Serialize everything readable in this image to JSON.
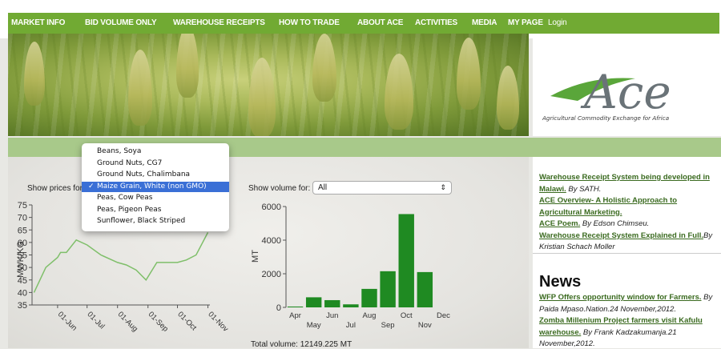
{
  "nav": {
    "items": [
      "MARKET INFO",
      "BID VOLUME ONLY",
      "WAREHOUSE RECEIPTS",
      "HOW TO TRADE",
      "ABOUT ACE",
      "ACTIVITIES",
      "MEDIA",
      "MY PAGE"
    ],
    "login": "Login"
  },
  "logo": {
    "mark": "Ace",
    "tagline": "Agricultural Commodity Exchange for Africa"
  },
  "prices": {
    "label": "Show prices for",
    "options": [
      "Beans, Soya",
      "Ground Nuts, CG7",
      "Ground Nuts, Chalimbana",
      "Maize Grain, White (non GMO)",
      "Peas, Cow Peas",
      "Peas, Pigeon Peas",
      "Sunflower, Black Striped"
    ],
    "selected": "Maize Grain, White (non GMO)",
    "check": "✓"
  },
  "volume": {
    "label": "Show volume for:",
    "select_value": "All",
    "select_arrow": "⇕",
    "total": "Total volume: 12149.225 MT"
  },
  "colors": {
    "accent": "#71aa33",
    "bar": "#1f8a22",
    "line": "#7fbf6a",
    "link": "#3a6a1f",
    "selected": "#3a6fd6"
  },
  "chart_data": [
    {
      "type": "line",
      "ylabel": "MWK/KG",
      "ylim": [
        35,
        75
      ],
      "yticks": [
        35,
        40,
        45,
        50,
        55,
        60,
        65,
        70,
        75
      ],
      "xticks": [
        "01-Jun",
        "01-Jul",
        "01-Aug",
        "01-Sep",
        "01-Oct",
        "01-Nov"
      ],
      "x": [
        "2012-05-08",
        "2012-05-20",
        "2012-06-01",
        "2012-06-04",
        "2012-06-10",
        "2012-06-20",
        "2012-07-01",
        "2012-07-15",
        "2012-08-01",
        "2012-08-10",
        "2012-08-20",
        "2012-08-30",
        "2012-09-10",
        "2012-09-25",
        "2012-10-01",
        "2012-10-10",
        "2012-10-20",
        "2012-11-01"
      ],
      "y": [
        40,
        50,
        54,
        56,
        56,
        61,
        59,
        55,
        52,
        51,
        49,
        45,
        52,
        52,
        52,
        53,
        55,
        64
      ]
    },
    {
      "type": "bar",
      "ylabel": "MT",
      "ylim": [
        0,
        6000
      ],
      "yticks": [
        0,
        2000,
        4000,
        6000
      ],
      "categories": [
        "Apr",
        "May",
        "Jun",
        "Jul",
        "Aug",
        "Sep",
        "Oct",
        "Nov",
        "Dec"
      ],
      "values": [
        50,
        600,
        430,
        180,
        1100,
        2150,
        5550,
        2100,
        0
      ],
      "top_labels": [
        "Apr",
        "Jun",
        "Aug",
        "Oct",
        "Dec"
      ],
      "bottom_labels": [
        "May",
        "Jul",
        "Sep",
        "Nov"
      ]
    }
  ],
  "articles": {
    "lines": [
      {
        "segments": [
          {
            "text": "Warehouse Receipt System being developed in",
            "link": true
          }
        ]
      },
      {
        "segments": [
          {
            "text": "Malawi.",
            "link": true
          },
          {
            "text": " By SATH.",
            "link": false
          }
        ]
      },
      {
        "segments": [
          {
            "text": "ACE Overview- A Holistic Approach to",
            "link": true
          }
        ]
      },
      {
        "segments": [
          {
            "text": "Agricultural Marketing.",
            "link": true
          }
        ]
      },
      {
        "segments": [
          {
            "text": "ACE Poem.",
            "link": true
          },
          {
            "text": " By Edson Chimseu.",
            "link": false
          }
        ]
      },
      {
        "segments": [
          {
            "text": "Warehouse Receipt System Explained in Full.",
            "link": true
          },
          {
            "text": "By",
            "link": false
          }
        ]
      },
      {
        "segments": [
          {
            "text": "Kristian Schach Moller",
            "link": false
          }
        ]
      }
    ]
  },
  "news": {
    "heading": "News",
    "lines": [
      {
        "segments": [
          {
            "text": "WFP Offers opportunity window for Farmers.",
            "link": true
          },
          {
            "text": " By",
            "link": false
          }
        ]
      },
      {
        "segments": [
          {
            "text": "Paida Mpaso.Nation.24 November,2012.",
            "link": false
          }
        ]
      },
      {
        "segments": [
          {
            "text": "Zomba Millenium Project farmers visit Kafulu",
            "link": true
          }
        ]
      },
      {
        "segments": [
          {
            "text": "warehouse.",
            "link": true
          },
          {
            "text": " By Frank Kadzakumanja.21",
            "link": false
          }
        ]
      },
      {
        "segments": [
          {
            "text": "November,2012.",
            "link": false
          }
        ]
      }
    ]
  }
}
